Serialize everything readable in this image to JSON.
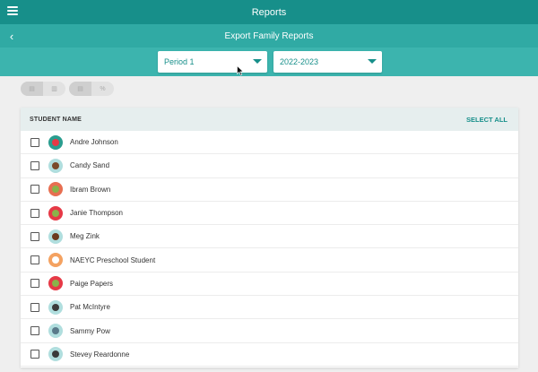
{
  "header": {
    "title": "Reports",
    "menu_icon": "hamburger-menu-icon"
  },
  "subheader": {
    "title": "Export Family Reports",
    "back_icon": "chevron-left-icon",
    "back_glyph": "‹"
  },
  "filters": {
    "period": {
      "selected": "Period 1",
      "icon": "caret-down-icon"
    },
    "year": {
      "selected": "2022-2023",
      "icon": "caret-down-icon"
    }
  },
  "view_toggles": [
    {
      "segments": [
        {
          "icon": "table-icon",
          "glyph": "▤",
          "active": true
        },
        {
          "icon": "bar-chart-icon",
          "glyph": "▥",
          "active": false
        }
      ]
    },
    {
      "segments": [
        {
          "icon": "list-icon",
          "glyph": "▤",
          "active": true
        },
        {
          "icon": "percent-icon",
          "glyph": "%",
          "active": false
        }
      ]
    }
  ],
  "table": {
    "column_header": "STUDENT NAME",
    "select_all_label": "SELECT ALL",
    "students": [
      {
        "name": "Andre Johnson",
        "avatar_bg": "#2a9d8f",
        "avatar_fg": "#e63946"
      },
      {
        "name": "Candy Sand",
        "avatar_bg": "#b0dede",
        "avatar_fg": "#7a4a2a"
      },
      {
        "name": "Ibram Brown",
        "avatar_bg": "#e76f51",
        "avatar_fg": "#8ab34a"
      },
      {
        "name": "Janie Thompson",
        "avatar_bg": "#e63946",
        "avatar_fg": "#8ab34a"
      },
      {
        "name": "Meg Zink",
        "avatar_bg": "#b0dede",
        "avatar_fg": "#6b3a1e"
      },
      {
        "name": "NAEYC Preschool Student",
        "avatar_bg": "#f4a261",
        "avatar_fg": "#ffffff"
      },
      {
        "name": "Paige Papers",
        "avatar_bg": "#e63946",
        "avatar_fg": "#8ab34a"
      },
      {
        "name": "Pat McIntyre",
        "avatar_bg": "#b0dede",
        "avatar_fg": "#3a3a3a"
      },
      {
        "name": "Sammy Pow",
        "avatar_bg": "#b0dede",
        "avatar_fg": "#5a7a8a"
      },
      {
        "name": "Stevey Reardonne",
        "avatar_bg": "#b0dede",
        "avatar_fg": "#3a3a3a"
      }
    ]
  },
  "colors": {
    "primary": "#178f8a",
    "primary_light": "#30aaa4",
    "filter_bar": "#3cb4ae"
  }
}
